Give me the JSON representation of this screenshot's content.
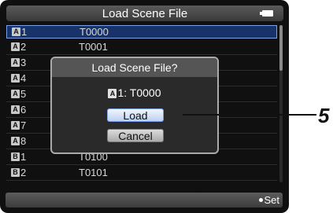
{
  "header": {
    "title": "Load Scene File"
  },
  "list": {
    "rows": [
      {
        "badge": "A",
        "index": "1",
        "name": "T0000"
      },
      {
        "badge": "A",
        "index": "2",
        "name": "T0001"
      },
      {
        "badge": "A",
        "index": "3",
        "name": ""
      },
      {
        "badge": "A",
        "index": "4",
        "name": ""
      },
      {
        "badge": "A",
        "index": "5",
        "name": ""
      },
      {
        "badge": "A",
        "index": "6",
        "name": ""
      },
      {
        "badge": "A",
        "index": "7",
        "name": ""
      },
      {
        "badge": "A",
        "index": "8",
        "name": ""
      },
      {
        "badge": "B",
        "index": "1",
        "name": "T0100"
      },
      {
        "badge": "B",
        "index": "2",
        "name": "T0101"
      }
    ]
  },
  "dialog": {
    "title": "Load Scene File?",
    "file_badge": "A",
    "file_text": "1: T0000",
    "load_label": "Load",
    "cancel_label": "Cancel"
  },
  "footer": {
    "set_label": "Set"
  },
  "callout": {
    "number": "5"
  },
  "icons": {
    "battery": "battery-icon",
    "set_dot": "dot-icon"
  },
  "colors": {
    "selection": "#18326a",
    "selection_border": "#7aa0e8"
  }
}
